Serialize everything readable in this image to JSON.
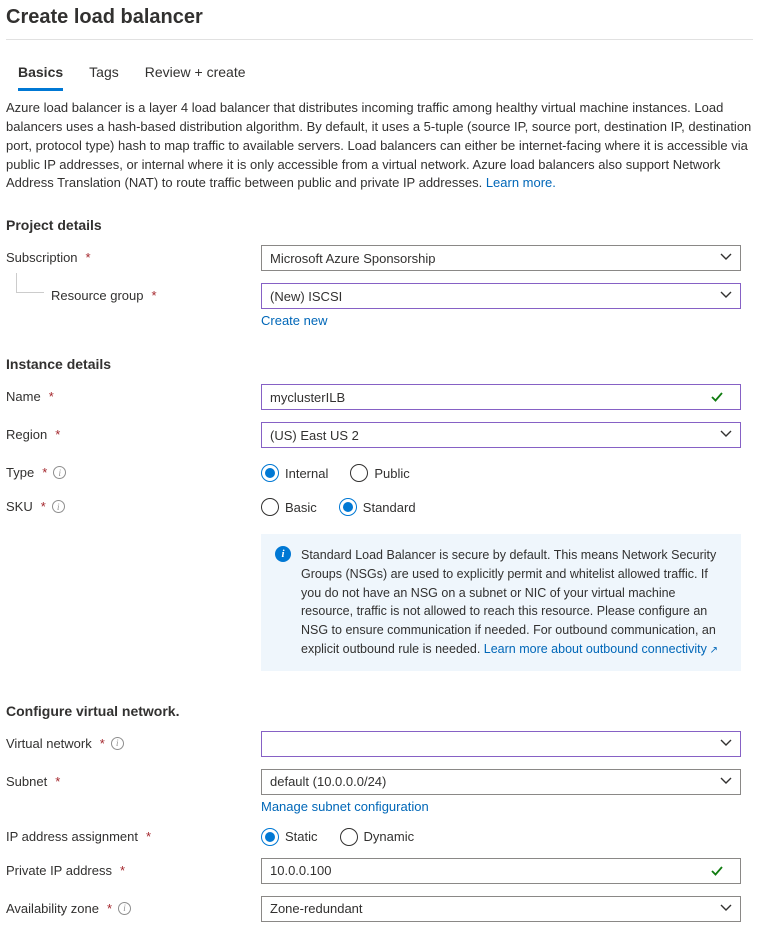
{
  "title": "Create load balancer",
  "tabs": {
    "basics": "Basics",
    "tags": "Tags",
    "review": "Review + create"
  },
  "description": "Azure load balancer is a layer 4 load balancer that distributes incoming traffic among healthy virtual machine instances. Load balancers uses a hash-based distribution algorithm. By default, it uses a 5-tuple (source IP, source port, destination IP, destination port, protocol type) hash to map traffic to available servers. Load balancers can either be internet-facing where it is accessible via public IP addresses, or internal where it is only accessible from a virtual network. Azure load balancers also support Network Address Translation (NAT) to route traffic between public and private IP addresses.  ",
  "learn_more": "Learn more.",
  "sections": {
    "project": "Project details",
    "instance": "Instance details",
    "network": "Configure virtual network."
  },
  "labels": {
    "subscription": "Subscription",
    "resource_group": "Resource group",
    "name": "Name",
    "region": "Region",
    "type": "Type",
    "sku": "SKU",
    "virtual_network": "Virtual network",
    "subnet": "Subnet",
    "ip_assignment": "IP address assignment",
    "private_ip": "Private IP address",
    "availability_zone": "Availability zone"
  },
  "values": {
    "subscription": "Microsoft Azure Sponsorship",
    "resource_group": "(New) ISCSI",
    "name": "myclusterILB",
    "region": "(US) East US 2",
    "type_internal": "Internal",
    "type_public": "Public",
    "sku_basic": "Basic",
    "sku_standard": "Standard",
    "virtual_network": "",
    "subnet": "default (10.0.0.0/24)",
    "ip_static": "Static",
    "ip_dynamic": "Dynamic",
    "private_ip": "10.0.0.100",
    "availability_zone": "Zone-redundant"
  },
  "links": {
    "create_new": "Create new",
    "manage_subnet": "Manage subnet configuration",
    "outbound": "Learn more about outbound connectivity"
  },
  "infobox": "Standard Load Balancer is secure by default.  This means Network Security Groups (NSGs) are used to explicitly permit and whitelist allowed traffic. If you do not have an NSG on a subnet or NIC of your virtual machine resource, traffic is not allowed to reach this resource. Please configure an NSG to ensure communication if needed.  For outbound communication, an explicit outbound rule is needed.  "
}
